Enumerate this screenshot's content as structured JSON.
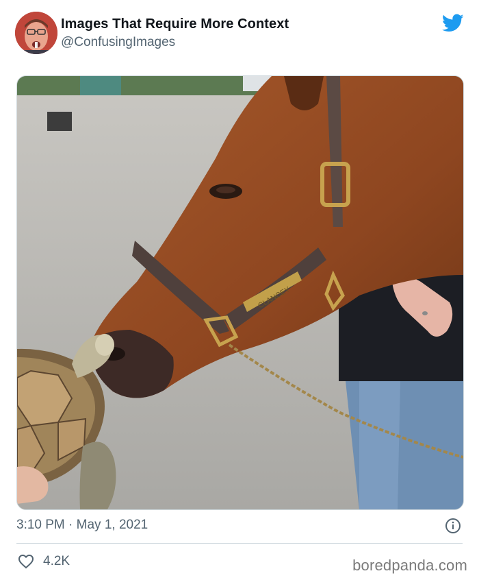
{
  "tweet": {
    "author_name": "Images That Require More Context",
    "author_handle": "@ConfusingImages",
    "timestamp": "3:10 PM · May 1, 2021",
    "like_count": "4.2K"
  },
  "photo": {
    "halter_nameplate": "CLANCEY"
  },
  "footer": {
    "watermark": "boredpanda.com"
  },
  "icons": {
    "twitter": "twitter-bird-icon",
    "info": "info-icon",
    "like": "heart-icon"
  },
  "colors": {
    "twitter_blue": "#1d9bf0",
    "text_primary": "#0f1419",
    "text_secondary": "#536471",
    "border": "#cfd9de"
  }
}
